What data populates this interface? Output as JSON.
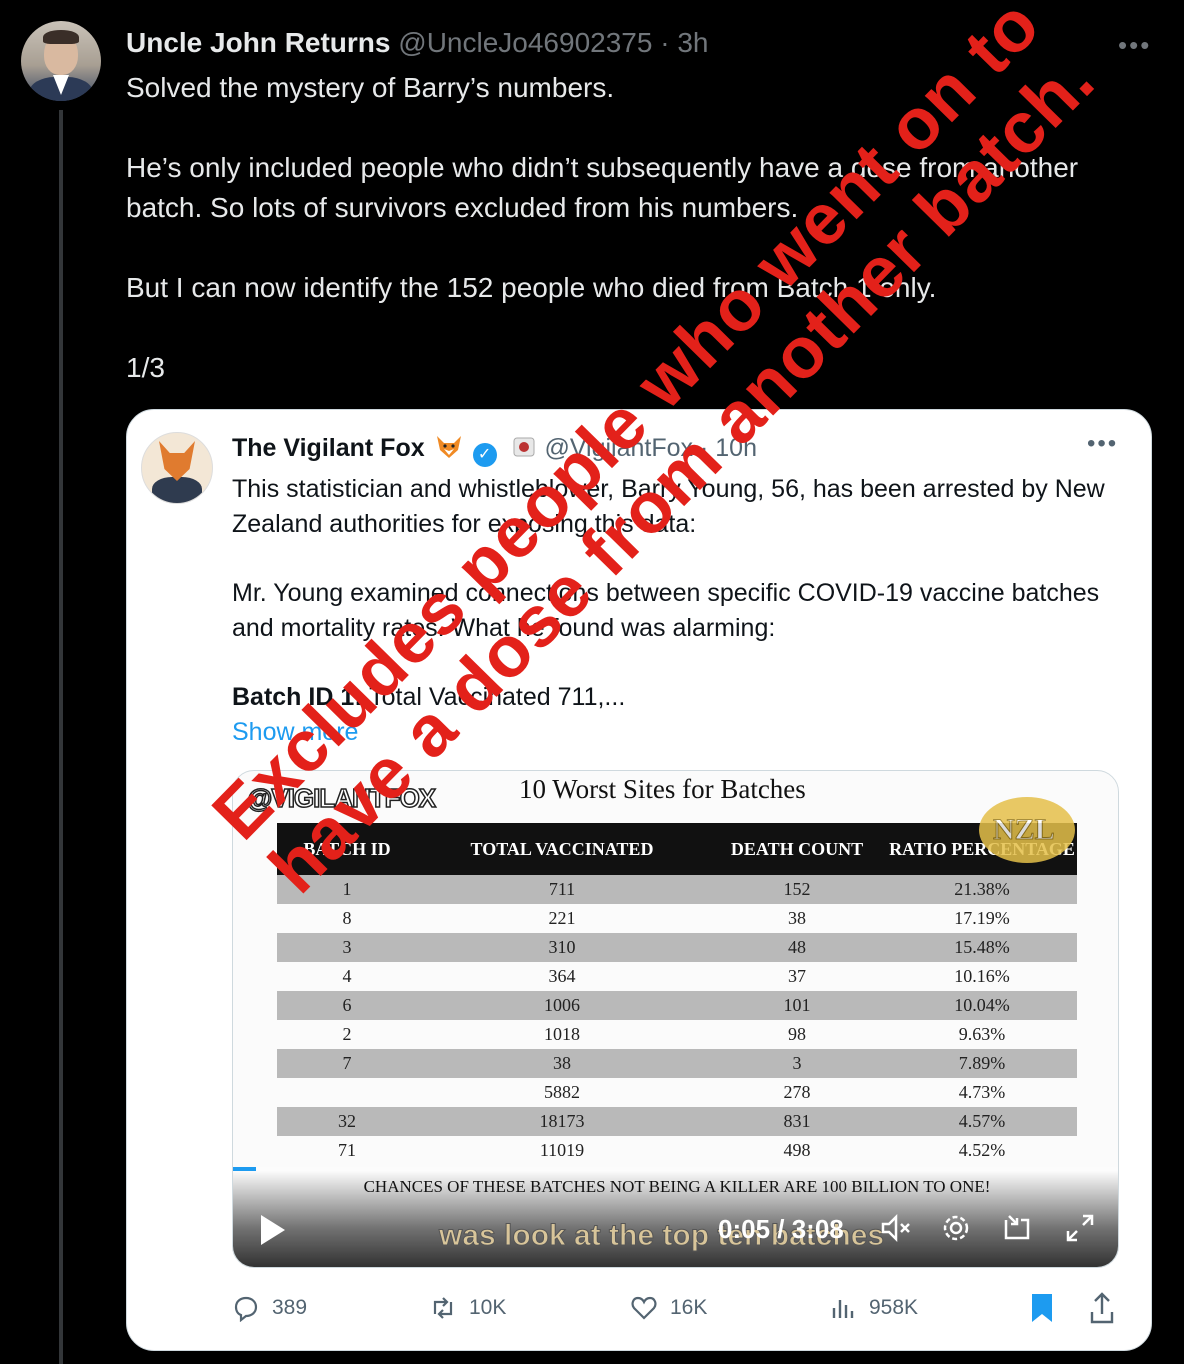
{
  "tweet": {
    "author_name": "Uncle John Returns",
    "author_handle": "@UncleJo46902375",
    "time": "3h",
    "text": [
      "Solved the mystery of Barry’s numbers.",
      "He’s only included people who didn’t subsequently have a dose from another batch. So lots of survivors excluded from his numbers.",
      "But I can now identify the 152 people who died from Batch 1 only.",
      "1/3"
    ],
    "more_icon": "ellipsis-icon"
  },
  "quote": {
    "author_name": "The Vigilant Fox",
    "author_handle": "@VigilantFox",
    "time": "10h",
    "text1": "This statistician and whistleblower, Barry Young, 56, has been arrested by New Zealand authorities for exposing this data:",
    "text2": "Mr. Young examined connections between specific COVID-19 vaccine batches and mortality rates. What he found was alarming:",
    "text3_bold": "Batch ID 1:",
    "text3_rest": " Total Vaccinated 711,...",
    "show_more": "Show more",
    "media": {
      "watermark": "@VIGILANTFOX",
      "title": "10 Worst Sites for Batches",
      "logo": "NZL",
      "headers": [
        "BATCH ID",
        "TOTAL VACCINATED",
        "DEATH COUNT",
        "RATIO PERCENTAGE"
      ],
      "rows": [
        [
          "1",
          "711",
          "152",
          "21.38%"
        ],
        [
          "8",
          "221",
          "38",
          "17.19%"
        ],
        [
          "3",
          "310",
          "48",
          "15.48%"
        ],
        [
          "4",
          "364",
          "37",
          "10.16%"
        ],
        [
          "6",
          "1006",
          "101",
          "10.04%"
        ],
        [
          "2",
          "1018",
          "98",
          "9.63%"
        ],
        [
          "7",
          "38",
          "3",
          "7.89%"
        ],
        [
          "",
          "5882",
          "278",
          "4.73%"
        ],
        [
          "32",
          "18173",
          "831",
          "4.57%"
        ],
        [
          "71",
          "11019",
          "498",
          "4.52%"
        ]
      ],
      "chances": "CHANCES OF THESE BATCHES NOT BEING A KILLER ARE 100 BILLION TO ONE!",
      "caption": "was look at the top ten batches",
      "time_display": "0:05 / 3:08",
      "progress_fraction": 0.026
    },
    "actions": {
      "replies": "389",
      "retweets": "10K",
      "likes": "16K",
      "views": "958K"
    }
  },
  "overlay": {
    "line1": "Excludes people who went on to",
    "line2": "have a dose from another batch.",
    "color": "#e3211a"
  }
}
